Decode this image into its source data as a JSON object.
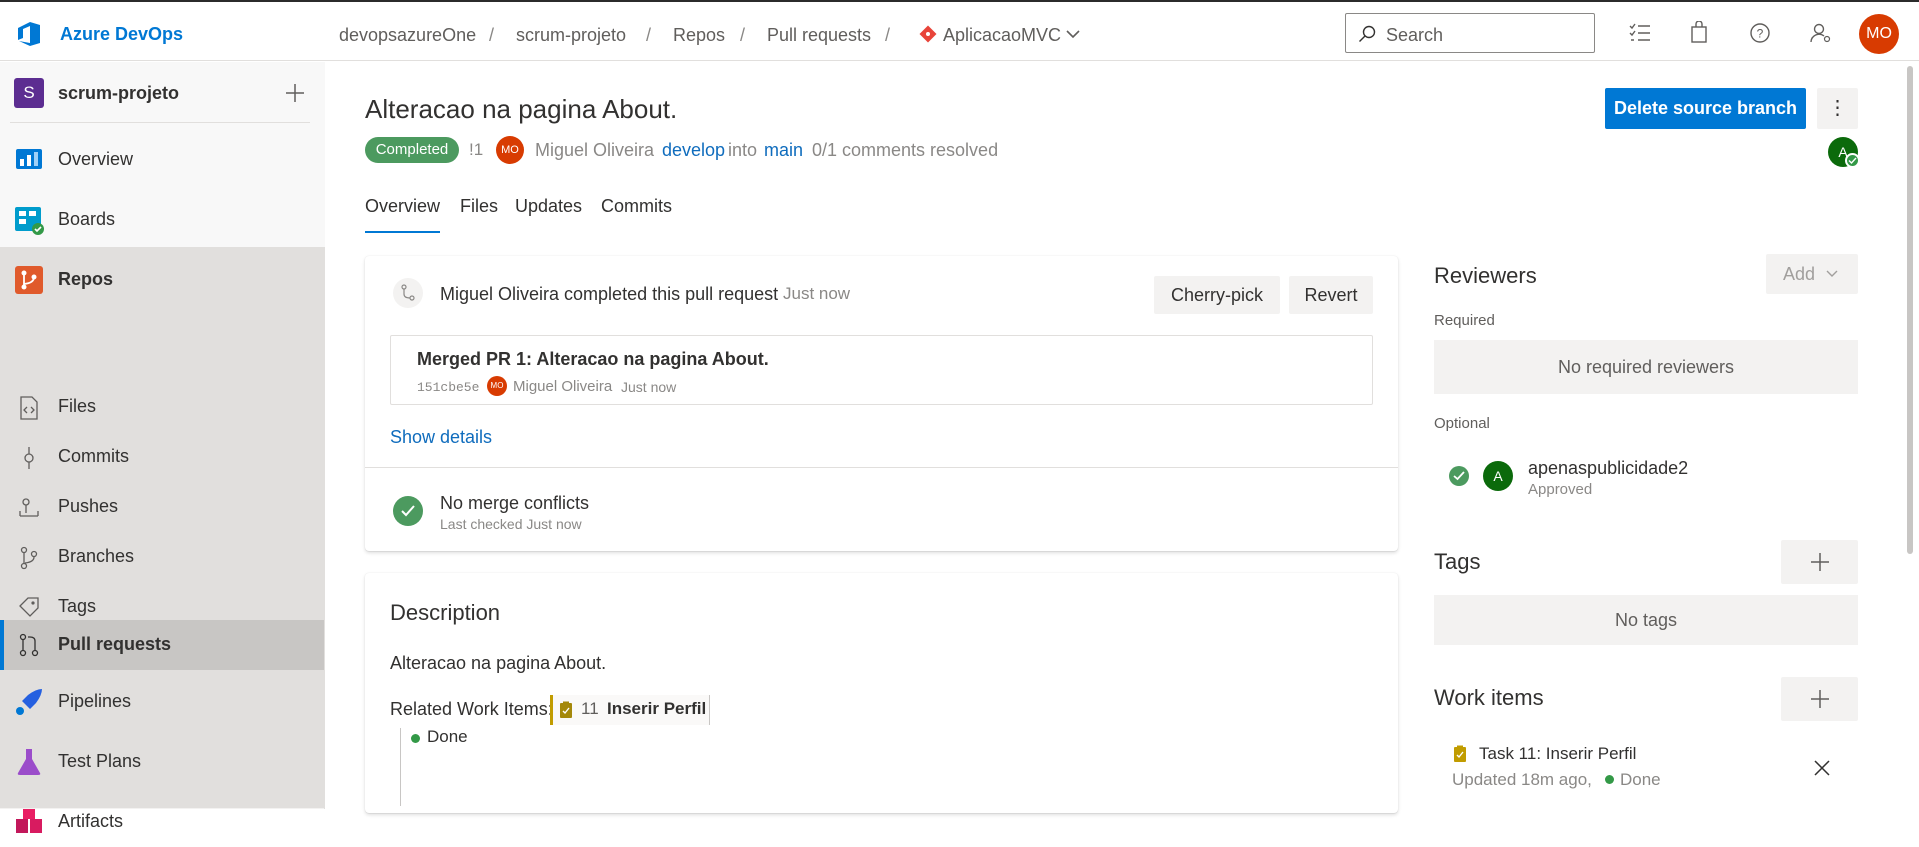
{
  "header": {
    "app_name": "Azure DevOps",
    "breadcrumbs": [
      "devopsazureOne",
      "scrum-projeto",
      "Repos",
      "Pull requests"
    ],
    "separator": "/",
    "repo_name": "AplicacaoMVC",
    "search_placeholder": "Search",
    "user_initials": "MO"
  },
  "sidebar": {
    "project_initial": "S",
    "project_name": "scrum-projeto",
    "items": [
      {
        "label": "Overview"
      },
      {
        "label": "Boards"
      },
      {
        "label": "Repos"
      },
      {
        "label": "Files"
      },
      {
        "label": "Commits"
      },
      {
        "label": "Pushes"
      },
      {
        "label": "Branches"
      },
      {
        "label": "Tags"
      },
      {
        "label": "Pull requests"
      },
      {
        "label": "Pipelines"
      },
      {
        "label": "Test Plans"
      },
      {
        "label": "Artifacts"
      }
    ]
  },
  "pr": {
    "title": "Alteracao na pagina About.",
    "status": "Completed",
    "id": "!1",
    "author_initials": "MO",
    "author": "Miguel Oliveira",
    "source_branch": "develop",
    "into": "into",
    "target_branch": "main",
    "comments": "0/1 comments resolved",
    "delete_branch_label": "Delete source branch",
    "more_label": "⋮",
    "tabs": [
      "Overview",
      "Files",
      "Updates",
      "Commits"
    ]
  },
  "activity": {
    "completed_text": "Miguel Oliveira completed this pull request",
    "completed_time": "Just now",
    "cherry_pick": "Cherry-pick",
    "revert": "Revert",
    "merge_title": "Merged PR 1: Alteracao na pagina About.",
    "commit_hash": "151cbe5e",
    "commit_author_initials": "MO",
    "commit_author": "Miguel Oliveira",
    "commit_time": "Just now",
    "show_details": "Show details",
    "conflicts_title": "No merge conflicts",
    "conflicts_sub": "Last checked Just now"
  },
  "description": {
    "heading": "Description",
    "text": "Alteracao na pagina About.",
    "related_label": "Related Work Items:",
    "work_item_id": "11",
    "work_item_title": "Inserir Perfil",
    "work_item_state": "Done"
  },
  "reviewers": {
    "title": "Reviewers",
    "add_label": "Add",
    "required_label": "Required",
    "no_required": "No required reviewers",
    "optional_label": "Optional",
    "reviewer_initial": "A",
    "reviewer_name": "apenaspublicidade2",
    "reviewer_status": "Approved"
  },
  "tags": {
    "title": "Tags",
    "empty": "No tags"
  },
  "work_items": {
    "title": "Work items",
    "item_title": "Task 11: Inserir Perfil",
    "item_updated": "Updated 18m ago,",
    "item_state": "Done"
  },
  "colors": {
    "accent": "#0078d4",
    "completed_badge": "#4c9a5f",
    "avatar_orange": "#d83b01",
    "success_green": "#339947",
    "project_purple": "#5c2d91"
  }
}
